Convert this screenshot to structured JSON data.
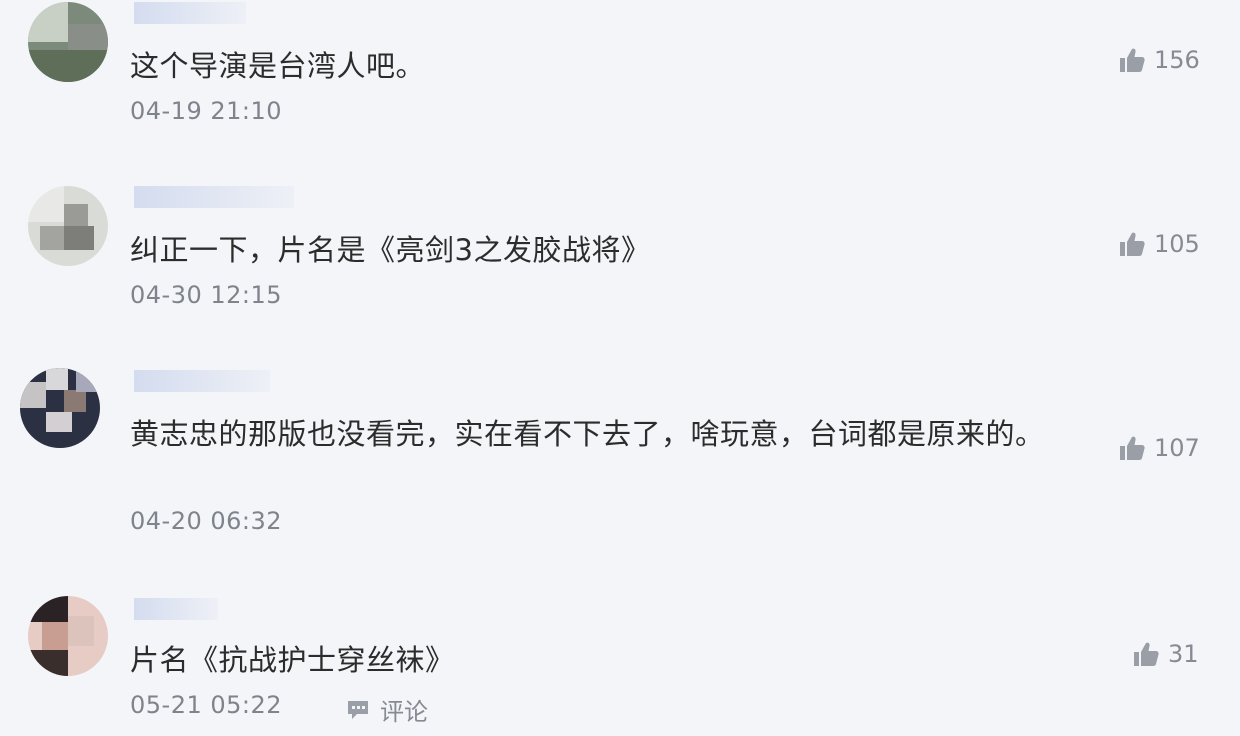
{
  "comments": [
    {
      "text": "这个导演是台湾人吧。",
      "time": "04-19 21:10",
      "likes": "156"
    },
    {
      "text": "纠正一下，片名是《亮剑3之发胶战将》",
      "time": "04-30 12:15",
      "likes": "105"
    },
    {
      "text": "黄志忠的那版也没看完，实在看不下去了，啥玩意，台词都是原来的。",
      "time": "04-20 06:32",
      "likes": "107"
    },
    {
      "text": "片名《抗战护士穿丝袜》",
      "time": "05-21 05:22",
      "likes": "31",
      "reply_label": "评论"
    }
  ],
  "icons": {
    "like": "thumbs-up-icon",
    "reply": "comment-bubble-icon"
  },
  "colors": {
    "background": "#f4f5f9",
    "text": "#2c2c2c",
    "meta": "#868a93"
  }
}
